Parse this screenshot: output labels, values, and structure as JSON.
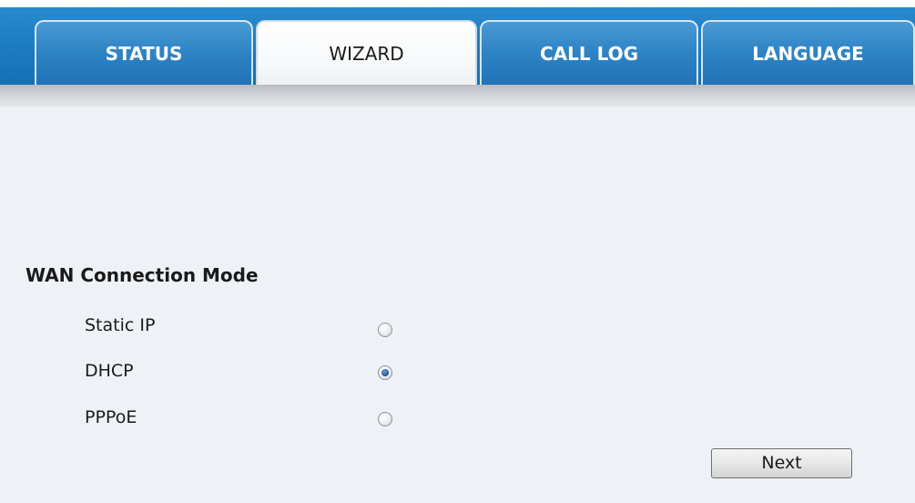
{
  "tabs": [
    {
      "label": "STATUS",
      "active": false
    },
    {
      "label": "WIZARD",
      "active": true
    },
    {
      "label": "CALL LOG",
      "active": false
    },
    {
      "label": "LANGUAGE",
      "active": false
    }
  ],
  "wan": {
    "title": "WAN Connection Mode",
    "options": [
      {
        "label": "Static IP",
        "selected": false
      },
      {
        "label": "DHCP",
        "selected": true
      },
      {
        "label": "PPPoE",
        "selected": false
      }
    ]
  },
  "actions": {
    "next_label": "Next"
  },
  "colors": {
    "banner": "#1e7fc4",
    "content_background": "#eef2f6"
  }
}
